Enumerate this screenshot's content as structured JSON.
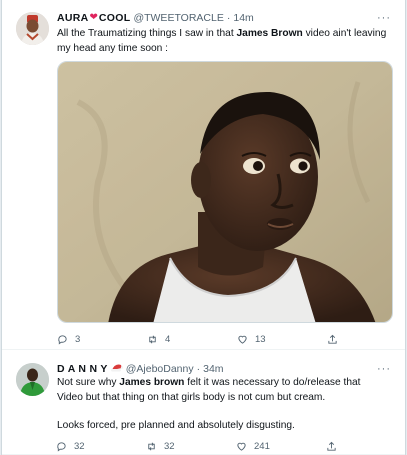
{
  "tweets": [
    {
      "name": "AURA",
      "name_suffix": "COOL",
      "name_emoji": "heart-emoji",
      "handle": "@TWEETORACLE",
      "dot": "·",
      "time": "14m",
      "more": "···",
      "text_parts": [
        "All the Traumatizing things I saw in that ",
        "James Brown",
        " video ain't leaving my head any time soon :"
      ],
      "counts": {
        "reply": "3",
        "retweet": "4",
        "like": "13"
      }
    },
    {
      "name": "D A N N Y",
      "name_emoji": "santa-hat-emoji",
      "handle": "@AjeboDanny",
      "dot": "·",
      "time": "34m",
      "more": "···",
      "text_parts": [
        "Not sure why ",
        "James brown",
        " felt it was necessary to do/release that Video but that thing on that girls body is not cum but cream."
      ],
      "text_line2": "Looks forced, pre planned and absolutely disgusting.",
      "counts": {
        "reply": "32",
        "retweet": "32",
        "like": "241"
      }
    }
  ],
  "colors": {
    "text": "#0f1419",
    "secondary": "#536471",
    "heart": "#e0245e",
    "border": "#cfd9de"
  }
}
